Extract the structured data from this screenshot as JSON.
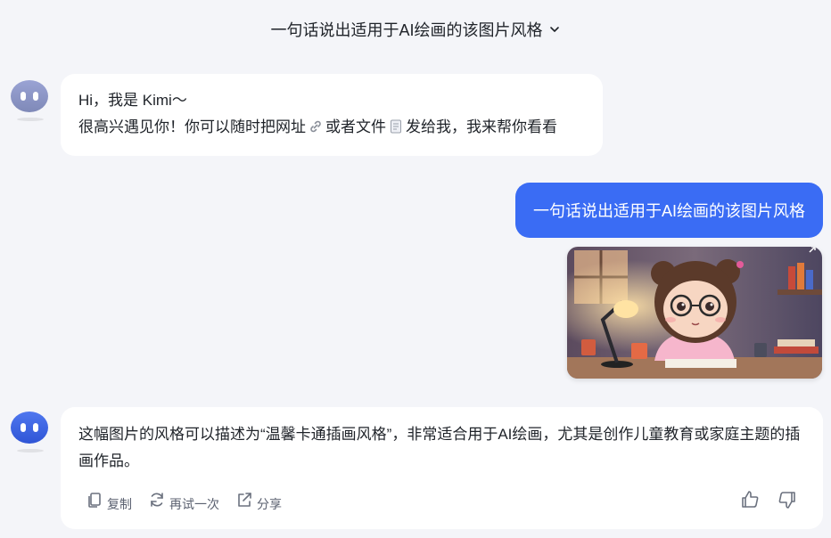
{
  "header": {
    "title": "一句话说出适用于AI绘画的该图片风格",
    "dropdown_icon": "chevron-down-icon"
  },
  "assistant": {
    "avatar_icon": "kimi-avatar-icon",
    "avatar_color": "#8b95c9",
    "avatar_color_active": "#3b62e5"
  },
  "greeting": {
    "line1": "Hi，我是 Kimi～",
    "line2_part1": "很高兴遇见你！你可以随时把网址",
    "line2_part2": "或者文件",
    "line2_part3": "发给我，我来帮你看看",
    "link_icon": "link-icon",
    "file_icon": "file-icon"
  },
  "user_message": {
    "text": "一句话说出适用于AI绘画的该图片风格",
    "bubble_color": "#3a6cf4"
  },
  "uploaded_image": {
    "alt": "cartoon girl with glasses studying at desk",
    "expand_icon": "expand-icon"
  },
  "answer": {
    "text": "这幅图片的风格可以描述为“温馨卡通插画风格”，非常适合用于AI绘画，尤其是创作儿童教育或家庭主题的插画作品。",
    "actions": {
      "copy": "复制",
      "retry": "再试一次",
      "share": "分享"
    },
    "feedback": {
      "like_icon": "thumbs-up-icon",
      "dislike_icon": "thumbs-down-icon"
    }
  }
}
